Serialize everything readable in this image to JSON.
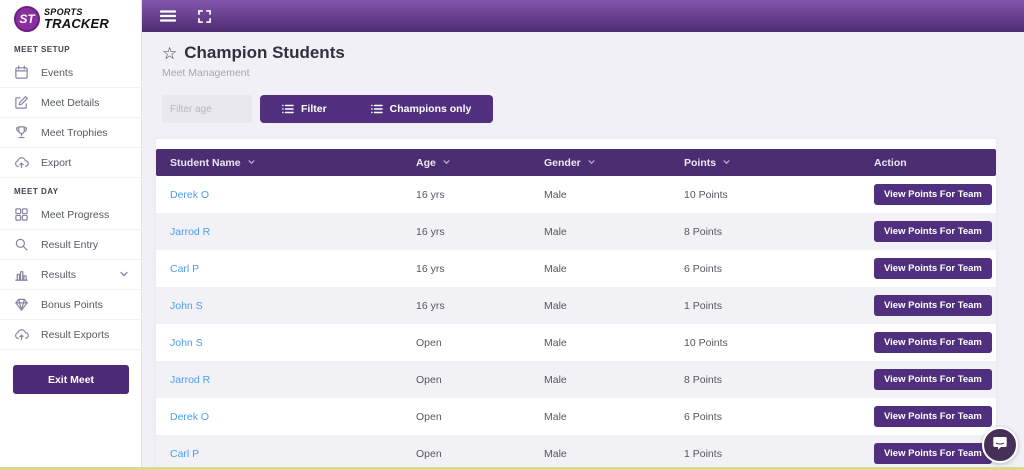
{
  "brand": {
    "monogram": "ST",
    "name_top": "SPORTS",
    "name_bottom": "TRACKER"
  },
  "sidebar": {
    "sections": [
      {
        "label": "MEET SETUP",
        "items": [
          {
            "label": "Events"
          },
          {
            "label": "Meet Details"
          },
          {
            "label": "Meet Trophies"
          },
          {
            "label": "Export"
          }
        ]
      },
      {
        "label": "MEET DAY",
        "items": [
          {
            "label": "Meet Progress"
          },
          {
            "label": "Result Entry"
          },
          {
            "label": "Results"
          },
          {
            "label": "Bonus Points"
          },
          {
            "label": "Result Exports"
          }
        ]
      }
    ],
    "exit_button_label": "Exit Meet"
  },
  "page": {
    "title": "Champion Students",
    "subtitle": "Meet Management"
  },
  "filters": {
    "age_placeholder": "Filter age",
    "filter_button_label": "Filter",
    "champions_button_label": "Champions only"
  },
  "table": {
    "columns": [
      {
        "label": "Student Name",
        "sortable": true
      },
      {
        "label": "Age",
        "sortable": true
      },
      {
        "label": "Gender",
        "sortable": true
      },
      {
        "label": "Points",
        "sortable": true
      },
      {
        "label": "Action",
        "sortable": false
      }
    ],
    "action_button_label": "View Points For Team",
    "rows": [
      {
        "name": "Derek O",
        "age": "16 yrs",
        "gender": "Male",
        "points": "10 Points"
      },
      {
        "name": "Jarrod R",
        "age": "16 yrs",
        "gender": "Male",
        "points": "8 Points"
      },
      {
        "name": "Carl P",
        "age": "16 yrs",
        "gender": "Male",
        "points": "6 Points"
      },
      {
        "name": "John S",
        "age": "16 yrs",
        "gender": "Male",
        "points": "1 Points"
      },
      {
        "name": "John S",
        "age": "Open",
        "gender": "Male",
        "points": "10 Points"
      },
      {
        "name": "Jarrod R",
        "age": "Open",
        "gender": "Male",
        "points": "8 Points"
      },
      {
        "name": "Derek O",
        "age": "Open",
        "gender": "Male",
        "points": "6 Points"
      },
      {
        "name": "Carl P",
        "age": "Open",
        "gender": "Male",
        "points": "1 Points"
      }
    ]
  },
  "colors": {
    "topbar-grad-top": "#8257ab",
    "topbar-grad-bottom": "#4f2b72",
    "header-purple": "#4b2d71",
    "button-purple": "#50307e",
    "exit-purple": "#4c2a77",
    "link-blue": "#4c9df0",
    "stripe-gray": "#f1f1f6",
    "bottom-line": "#d9da90"
  }
}
